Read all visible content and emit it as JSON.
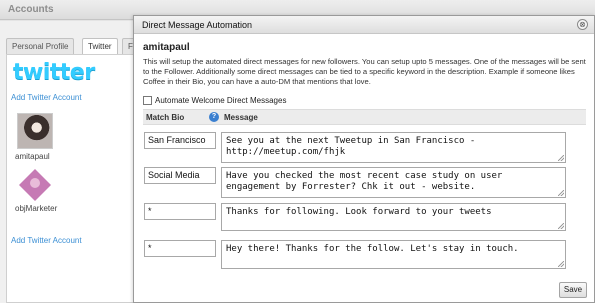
{
  "app": {
    "title": "Accounts"
  },
  "tabs": [
    {
      "label": "Personal Profile"
    },
    {
      "label": "Twitter"
    },
    {
      "label": "F"
    }
  ],
  "sidebar": {
    "logo_text": "twitter",
    "add_account_top": "Add Twitter Account",
    "accounts": [
      {
        "name": "amitapaul"
      },
      {
        "name": "objMarketer"
      }
    ],
    "add_account_bottom": "Add Twitter Account"
  },
  "modal": {
    "title": "Direct Message Automation",
    "close_glyph": "⊗",
    "username": "amitapaul",
    "description": "This will setup the automated direct messages for new followers. You can setup upto 5 messages. One of the messages will be sent to the Follower. Additionally some direct messages can be tied to a specific keyword in the description. Example if someone likes Coffee in their Bio, you can have a auto-DM that mentions that love.",
    "auto_welcome_label": "Automate Welcome Direct Messages",
    "auto_welcome_checked": false,
    "col_match_bio": "Match Bio",
    "help_glyph": "?",
    "col_message": "Message",
    "rows": [
      {
        "bio": "San Francisco",
        "message": "See you at the next Tweetup in San Francisco -\nhttp://meetup.com/fhjk"
      },
      {
        "bio": "Social Media",
        "message": "Have you checked the most recent case study on user\nengagement by Forrester? Chk it out - website."
      },
      {
        "bio": "*",
        "message": "Thanks for following. Look forward to your tweets"
      },
      {
        "bio": "*",
        "message": "Hey there! Thanks for the follow. Let's stay in touch."
      }
    ],
    "save_label": "Save"
  },
  "colors": {
    "twitter_logo": "#33ccff",
    "link": "#3b8fd4",
    "help_icon": "#3a7fd0"
  }
}
